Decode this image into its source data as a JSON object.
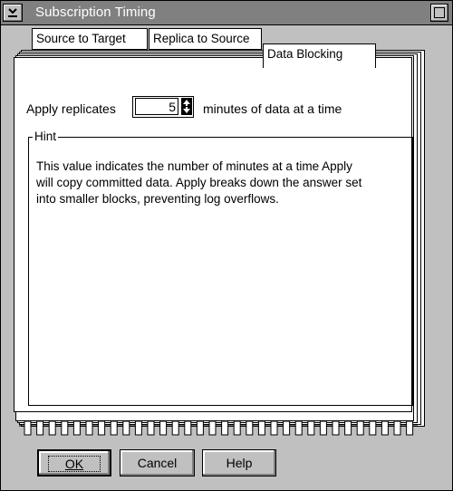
{
  "window": {
    "title": "Subscription Timing"
  },
  "tabs": [
    {
      "label": "Source to Target"
    },
    {
      "label": "Replica to Source"
    },
    {
      "label": "Data Blocking"
    }
  ],
  "blocking": {
    "prefix_label": "Apply replicates",
    "minutes_value": "5",
    "suffix_label": "minutes of data at a time"
  },
  "hint": {
    "legend": "Hint",
    "lines": [
      "This value indicates the number of minutes at a time Apply",
      "will copy committed data. Apply breaks down the answer set",
      "into smaller blocks, preventing log overflows."
    ]
  },
  "buttons": {
    "ok_label": "OK",
    "cancel_label": "Cancel",
    "help_label": "Help"
  },
  "icons": {
    "system_menu": "system-menu-icon",
    "maximize": "maximize-icon",
    "spin_up": "arrow-up-icon",
    "spin_down": "arrow-down-icon"
  }
}
